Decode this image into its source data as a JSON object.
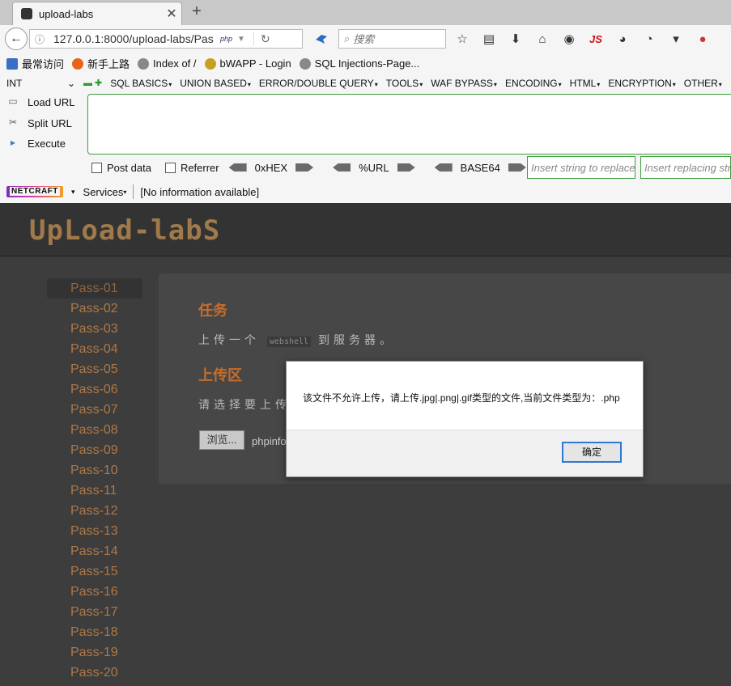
{
  "tab": {
    "title": "upload-labs"
  },
  "nav": {
    "url": "127.0.0.1:8000/upload-labs/Pas",
    "php_badge": "php",
    "search_placeholder": "搜索",
    "js_label": "JS"
  },
  "bookmarks": [
    {
      "label": "最常访问",
      "color": "#3a6fc4"
    },
    {
      "label": "新手上路",
      "color": "#e8641b"
    },
    {
      "label": "Index of /",
      "color": "#888888"
    },
    {
      "label": "bWAPP - Login",
      "color": "#c8a020"
    },
    {
      "label": "SQL Injections-Page...",
      "color": "#888888"
    }
  ],
  "hackbar": {
    "type_select": "INT",
    "menus": [
      "SQL BASICS",
      "UNION BASED",
      "ERROR/DOUBLE QUERY",
      "TOOLS",
      "WAF BYPASS",
      "ENCODING",
      "HTML",
      "ENCRYPTION",
      "OTHER"
    ],
    "load_url": "Load URL",
    "split_url": "Split URL",
    "execute": "Execute",
    "post_data": "Post data",
    "referrer": "Referrer",
    "hex": "0xHEX",
    "url_enc": "%URL",
    "base64": "BASE64",
    "insert_replace_placeholder": "Insert string to replace",
    "insert_replacing_placeholder": "Insert replacing string",
    "url_value": ""
  },
  "netcraft": {
    "logo": "NETCRAFT",
    "services": "Services",
    "info": "[No information available]"
  },
  "page": {
    "logo": "UpLoad-labS",
    "passes": [
      "Pass-01",
      "Pass-02",
      "Pass-03",
      "Pass-04",
      "Pass-05",
      "Pass-06",
      "Pass-07",
      "Pass-08",
      "Pass-09",
      "Pass-10",
      "Pass-11",
      "Pass-12",
      "Pass-13",
      "Pass-14",
      "Pass-15",
      "Pass-16",
      "Pass-17",
      "Pass-18",
      "Pass-19",
      "Pass-20"
    ],
    "task_heading": "任务",
    "task_text_before": "上传一个",
    "task_code": "webshell",
    "task_text_after": "到服务器。",
    "upload_heading": "上传区",
    "upload_hint": "请选择要上传",
    "browse_label": "浏览...",
    "file_name": "phpinfo"
  },
  "dialog": {
    "message": "该文件不允许上传，请上传.jpg|.png|.gif类型的文件,当前文件类型为：.php",
    "ok_label": "确定"
  }
}
